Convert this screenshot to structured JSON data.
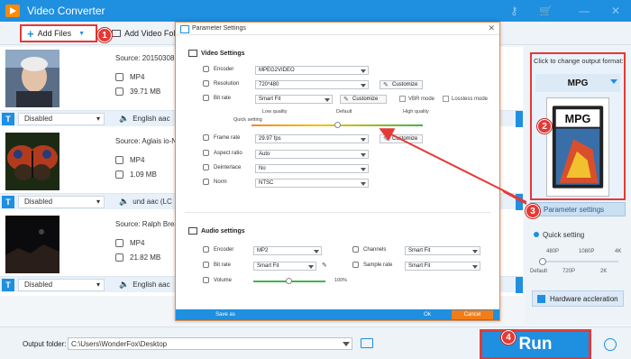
{
  "app": {
    "title": "Video Converter",
    "accent": "#1f8fe0",
    "highlight": "#e53935"
  },
  "toolbar": {
    "add_files": "Add Files",
    "add_folder": "Add Video Fold"
  },
  "badges": [
    "1",
    "2",
    "3",
    "4"
  ],
  "files": [
    {
      "source": "Source: 20150308 C",
      "format": "MP4",
      "size": "39.71 MB",
      "subtitle": "Disabled",
      "audio": "English aac"
    },
    {
      "source": "Source: Aglais io-NA",
      "format": "MP4",
      "size": "1.09 MB",
      "subtitle": "Disabled",
      "audio": "und aac (LC"
    },
    {
      "source": "Source: Ralph Brea",
      "format": "MP4",
      "size": "21.82 MB",
      "subtitle": "Disabled",
      "audio": "English aac"
    }
  ],
  "right_panel": {
    "hint": "Click to change output format:",
    "format": "MPG",
    "format_image_text": "MPG",
    "param_button": "Parameter settings",
    "quick_setting": "Quick setting",
    "quick_labels_top": [
      "480P",
      "1080P",
      "4K"
    ],
    "quick_labels_bottom": [
      "Default",
      "720P",
      "2K"
    ],
    "quick_level": 0.05,
    "hw_accel": "Hardware accleration"
  },
  "dialog": {
    "title": "Parameter Settings",
    "video_header": "Video Settings",
    "audio_header": "Audio settings",
    "video": {
      "encoder_label": "Encoder",
      "encoder": "MPEG2VIDEO",
      "resolution_label": "Resolution",
      "resolution": "720*480",
      "bitrate_label": "Bit rate",
      "bitrate": "Smart Fit",
      "customize": "Customize",
      "vbr": "VBR mode",
      "lossless": "Lossless mode",
      "quality_low": "Low quality",
      "quality_default": "Default",
      "quality_high": "High quality",
      "quick_setting": "Quick setting",
      "framerate_label": "Frame rate",
      "framerate": "29.97 fps",
      "aspect_label": "Aspect ratio",
      "aspect": "Auto",
      "deinterlace_label": "Deinterlace",
      "deinterlace": "No",
      "norm_label": "Norm",
      "norm": "NTSC"
    },
    "audio": {
      "encoder_label": "Encoder",
      "encoder": "MP2",
      "channels_label": "Channels",
      "channels": "Smart Fit",
      "bitrate_label": "Bit rate",
      "bitrate": "Smart Fit",
      "samplerate_label": "Sample rate",
      "samplerate": "Smart Fit",
      "volume_label": "Volume",
      "volume_value": "100%"
    },
    "save_as": "Save as",
    "ok": "Ok",
    "cancel": "Cancel"
  },
  "bottom": {
    "output_label": "Output folder:",
    "output_path": "C:\\Users\\WonderFox\\Desktop",
    "run": "Run"
  }
}
